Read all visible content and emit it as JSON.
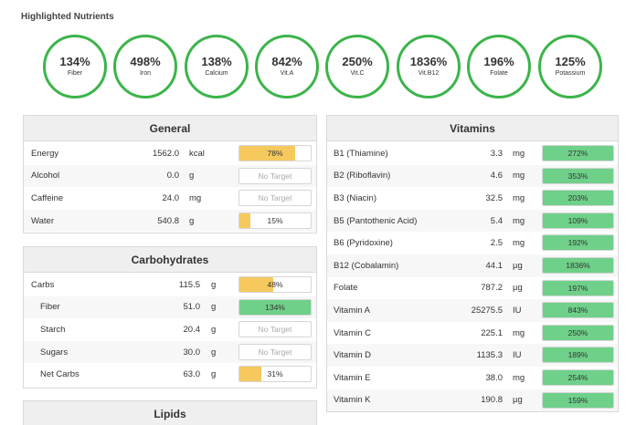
{
  "title": "Highlighted Nutrients",
  "colors": {
    "ring": "#3cb44b",
    "yellow": "#f6c95e",
    "green": "#6fd08a"
  },
  "highlights": [
    {
      "pct": "134%",
      "label": "Fiber"
    },
    {
      "pct": "498%",
      "label": "Iron"
    },
    {
      "pct": "138%",
      "label": "Calcium"
    },
    {
      "pct": "842%",
      "label": "Vit.A"
    },
    {
      "pct": "250%",
      "label": "Vit.C"
    },
    {
      "pct": "1836%",
      "label": "Vit.B12"
    },
    {
      "pct": "196%",
      "label": "Folate"
    },
    {
      "pct": "125%",
      "label": "Potassium"
    }
  ],
  "general": {
    "title": "General",
    "rows": [
      {
        "name": "Energy",
        "amount": "1562.0",
        "unit": "kcal",
        "bar": "78%",
        "fill": 0.78,
        "color": "yellow"
      },
      {
        "name": "Alcohol",
        "amount": "0.0",
        "unit": "g",
        "bar": "No Target",
        "fill": 0,
        "color": "none"
      },
      {
        "name": "Caffeine",
        "amount": "24.0",
        "unit": "mg",
        "bar": "No Target",
        "fill": 0,
        "color": "none"
      },
      {
        "name": "Water",
        "amount": "540.8",
        "unit": "g",
        "bar": "15%",
        "fill": 0.15,
        "color": "yellow"
      }
    ]
  },
  "carbohydrates": {
    "title": "Carbohydrates",
    "rows": [
      {
        "name": "Carbs",
        "amount": "115.5",
        "unit": "g",
        "bar": "48%",
        "fill": 0.48,
        "color": "yellow",
        "indent": false
      },
      {
        "name": "Fiber",
        "amount": "51.0",
        "unit": "g",
        "bar": "134%",
        "fill": 1,
        "color": "green",
        "indent": true
      },
      {
        "name": "Starch",
        "amount": "20.4",
        "unit": "g",
        "bar": "No Target",
        "fill": 0,
        "color": "none",
        "indent": true
      },
      {
        "name": "Sugars",
        "amount": "30.0",
        "unit": "g",
        "bar": "No Target",
        "fill": 0,
        "color": "none",
        "indent": true
      },
      {
        "name": "Net Carbs",
        "amount": "63.0",
        "unit": "g",
        "bar": "31%",
        "fill": 0.31,
        "color": "yellow",
        "indent": true
      }
    ]
  },
  "lipids": {
    "title": "Lipids"
  },
  "vitamins": {
    "title": "Vitamins",
    "rows": [
      {
        "name": "B1 (Thiamine)",
        "amount": "3.3",
        "unit": "mg",
        "bar": "272%",
        "fill": 1,
        "color": "green"
      },
      {
        "name": "B2 (Riboflavin)",
        "amount": "4.6",
        "unit": "mg",
        "bar": "353%",
        "fill": 1,
        "color": "green"
      },
      {
        "name": "B3 (Niacin)",
        "amount": "32.5",
        "unit": "mg",
        "bar": "203%",
        "fill": 1,
        "color": "green"
      },
      {
        "name": "B5 (Pantothenic Acid)",
        "amount": "5.4",
        "unit": "mg",
        "bar": "109%",
        "fill": 1,
        "color": "green"
      },
      {
        "name": "B6 (Pyridoxine)",
        "amount": "2.5",
        "unit": "mg",
        "bar": "192%",
        "fill": 1,
        "color": "green"
      },
      {
        "name": "B12 (Cobalamin)",
        "amount": "44.1",
        "unit": "µg",
        "bar": "1836%",
        "fill": 1,
        "color": "green"
      },
      {
        "name": "Folate",
        "amount": "787.2",
        "unit": "µg",
        "bar": "197%",
        "fill": 1,
        "color": "green"
      },
      {
        "name": "Vitamin A",
        "amount": "25275.5",
        "unit": "IU",
        "bar": "843%",
        "fill": 1,
        "color": "green"
      },
      {
        "name": "Vitamin C",
        "amount": "225.1",
        "unit": "mg",
        "bar": "250%",
        "fill": 1,
        "color": "green"
      },
      {
        "name": "Vitamin D",
        "amount": "1135.3",
        "unit": "IU",
        "bar": "189%",
        "fill": 1,
        "color": "green"
      },
      {
        "name": "Vitamin E",
        "amount": "38.0",
        "unit": "mg",
        "bar": "254%",
        "fill": 1,
        "color": "green"
      },
      {
        "name": "Vitamin K",
        "amount": "190.8",
        "unit": "µg",
        "bar": "159%",
        "fill": 1,
        "color": "green"
      }
    ]
  }
}
